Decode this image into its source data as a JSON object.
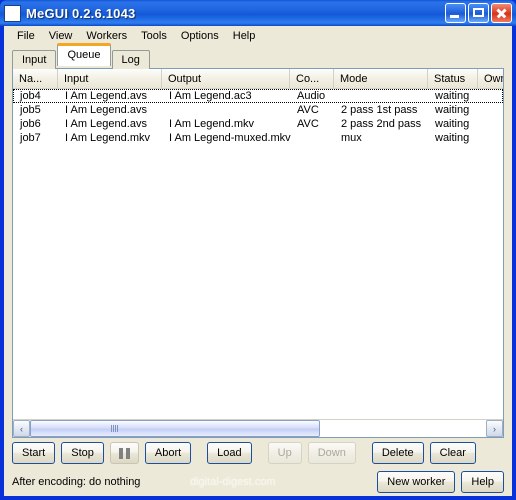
{
  "window": {
    "title": "MeGUI 0.2.6.1043",
    "icon": "app-window-icon",
    "minimize_label": "Minimize",
    "maximize_label": "Maximize",
    "close_label": "Close",
    "frame_color": "#0831d9",
    "titlebar_color": "#1e64e0"
  },
  "menubar": {
    "items": [
      {
        "label": "File"
      },
      {
        "label": "View"
      },
      {
        "label": "Workers"
      },
      {
        "label": "Tools"
      },
      {
        "label": "Options"
      },
      {
        "label": "Help"
      }
    ]
  },
  "tabs": {
    "active": "Queue",
    "active_accent": "#f5a623",
    "items": [
      {
        "label": "Input"
      },
      {
        "label": "Queue"
      },
      {
        "label": "Log"
      }
    ]
  },
  "queue_table": {
    "columns": [
      {
        "label": "Na...",
        "key": "name"
      },
      {
        "label": "Input",
        "key": "input"
      },
      {
        "label": "Output",
        "key": "output"
      },
      {
        "label": "Co...",
        "key": "codec"
      },
      {
        "label": "Mode",
        "key": "mode"
      },
      {
        "label": "Status",
        "key": "status"
      },
      {
        "label": "Owne",
        "key": "owner"
      }
    ],
    "rows": [
      {
        "name": "job4",
        "input": "I Am Legend.avs",
        "output": "I Am Legend.ac3",
        "codec": "Audio",
        "mode": "",
        "status": "waiting",
        "owner": "",
        "focused": true
      },
      {
        "name": "job5",
        "input": "I Am Legend.avs",
        "output": "",
        "codec": "AVC",
        "mode": "2 pass 1st pass",
        "status": "waiting",
        "owner": "",
        "focused": false
      },
      {
        "name": "job6",
        "input": "I Am Legend.avs",
        "output": "I Am Legend.mkv",
        "codec": "AVC",
        "mode": "2 pass 2nd pass",
        "status": "waiting",
        "owner": "",
        "focused": false
      },
      {
        "name": "job7",
        "input": "I Am Legend.mkv",
        "output": "I Am Legend-muxed.mkv",
        "codec": "",
        "mode": "mux",
        "status": "waiting",
        "owner": "",
        "focused": false
      }
    ]
  },
  "scrollbar": {
    "left_arrow": "‹",
    "right_arrow": "›",
    "grip": "scroll-grip"
  },
  "buttons": {
    "start": {
      "label": "Start",
      "enabled": true
    },
    "stop": {
      "label": "Stop",
      "enabled": true
    },
    "pause": {
      "label": "",
      "icon": "pause-icon",
      "enabled": true
    },
    "abort": {
      "label": "Abort",
      "enabled": true
    },
    "load": {
      "label": "Load",
      "enabled": true
    },
    "up": {
      "label": "Up",
      "enabled": false
    },
    "down": {
      "label": "Down",
      "enabled": false
    },
    "delete": {
      "label": "Delete",
      "enabled": true
    },
    "clear": {
      "label": "Clear",
      "enabled": true
    },
    "new_worker": {
      "label": "New worker",
      "enabled": true
    },
    "help": {
      "label": "Help",
      "enabled": true
    }
  },
  "status": {
    "after_encoding": "After encoding: do nothing",
    "watermark": "digital-digest.com"
  }
}
